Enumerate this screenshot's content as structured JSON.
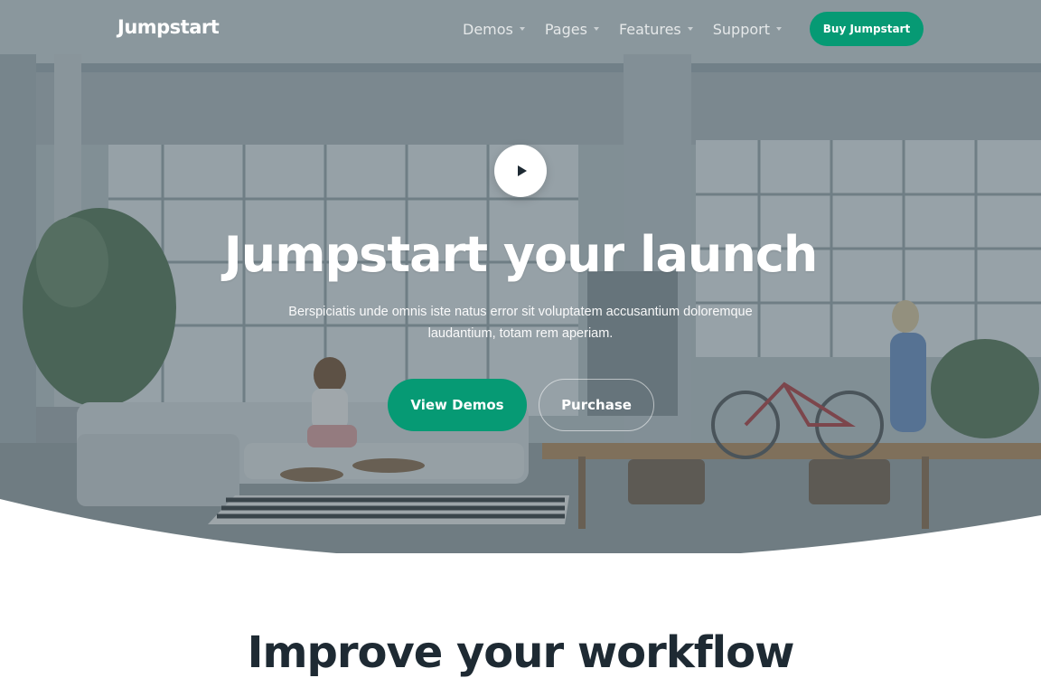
{
  "header": {
    "brand": "Jumpstart",
    "nav": [
      {
        "label": "Demos"
      },
      {
        "label": "Pages"
      },
      {
        "label": "Features"
      },
      {
        "label": "Support"
      }
    ],
    "cta_label": "Buy Jumpstart"
  },
  "hero": {
    "title": "Jumpstart your launch",
    "subtitle": "Berspiciatis unde omnis iste natus error sit voluptatem accusantium doloremque laudantium, totam rem aperiam.",
    "primary_button": "View Demos",
    "secondary_button": "Purchase",
    "play_icon": "play-icon"
  },
  "next_section": {
    "heading_partial": "Improve your workflow"
  },
  "colors": {
    "accent": "#069a74",
    "overlay": "#34444e",
    "text_dark": "#1e2a33"
  }
}
